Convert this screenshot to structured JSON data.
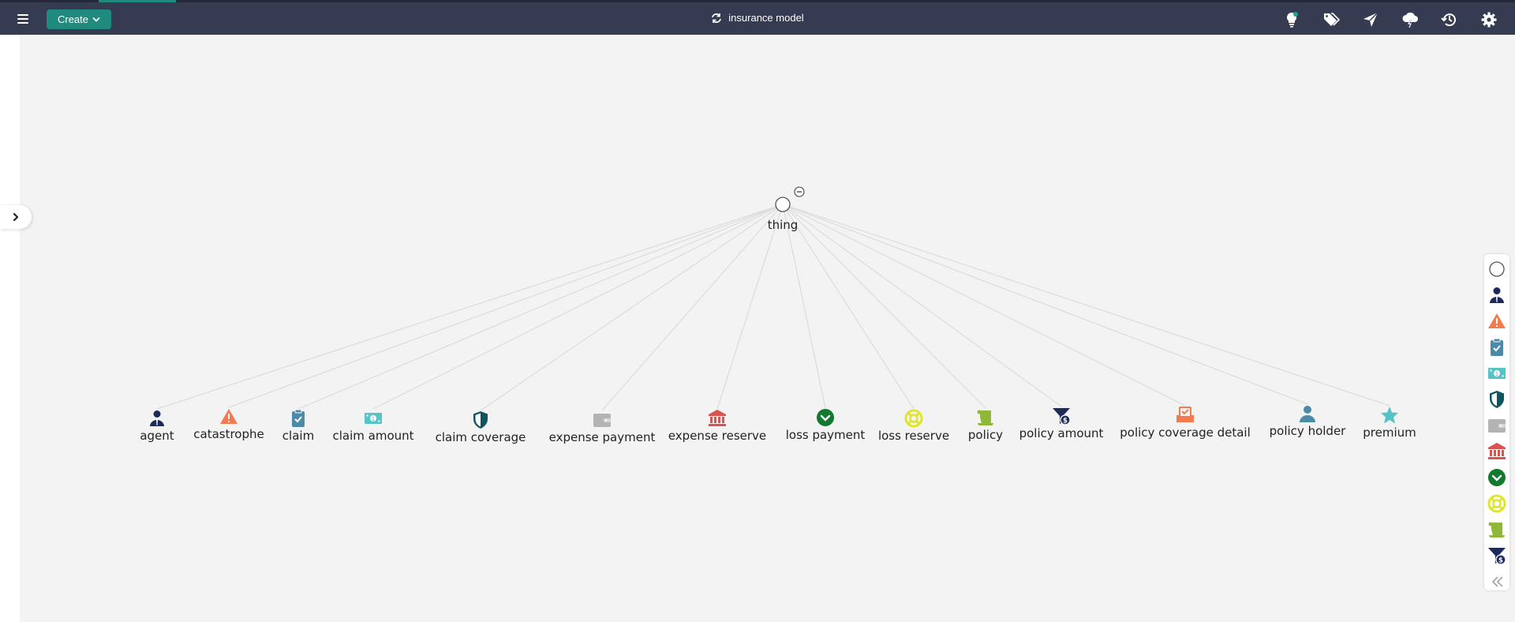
{
  "header": {
    "create_label": "Create",
    "title": "insurance model"
  },
  "toolbar_icons": [
    "lightbulb-icon",
    "tags-icon",
    "send-icon",
    "cloud-lightning-icon",
    "history-icon",
    "gear-icon"
  ],
  "graph": {
    "root": {
      "label": "thing",
      "icon": "circle-icon"
    },
    "nodes": [
      {
        "label": "agent",
        "icon": "agent-icon",
        "color": "#1d2a5c"
      },
      {
        "label": "catastrophe",
        "icon": "warning-icon",
        "color": "#f47b4f"
      },
      {
        "label": "claim",
        "icon": "clipboard-check-icon",
        "color": "#4b8ba8"
      },
      {
        "label": "claim amount",
        "icon": "money-bill-icon",
        "color": "#56c3c7"
      },
      {
        "label": "claim coverage",
        "icon": "shield-icon",
        "color": "#0e5562"
      },
      {
        "label": "expense payment",
        "icon": "wallet-icon",
        "color": "#b3b3b3"
      },
      {
        "label": "expense reserve",
        "icon": "bank-icon",
        "color": "#d9534f"
      },
      {
        "label": "loss payment",
        "icon": "check-circle-icon",
        "color": "#127a2e"
      },
      {
        "label": "loss reserve",
        "icon": "life-ring-icon",
        "color": "#dfe52e"
      },
      {
        "label": "policy",
        "icon": "scroll-icon",
        "color": "#8fb838"
      },
      {
        "label": "policy amount",
        "icon": "funnel-dollar-icon",
        "color": "#1d2a5c"
      },
      {
        "label": "policy coverage detail",
        "icon": "inbox-check-icon",
        "color": "#f47b4f"
      },
      {
        "label": "policy holder",
        "icon": "person-icon",
        "color": "#4b8ba8"
      },
      {
        "label": "premium",
        "icon": "star-icon",
        "color": "#56c3c7"
      }
    ]
  },
  "palette": [
    "circle-icon",
    "agent-icon",
    "warning-icon",
    "clipboard-check-icon",
    "money-bill-icon",
    "shield-icon",
    "wallet-icon",
    "bank-icon",
    "check-circle-icon",
    "life-ring-icon",
    "scroll-icon",
    "funnel-dollar-icon",
    "collapse-icon"
  ]
}
